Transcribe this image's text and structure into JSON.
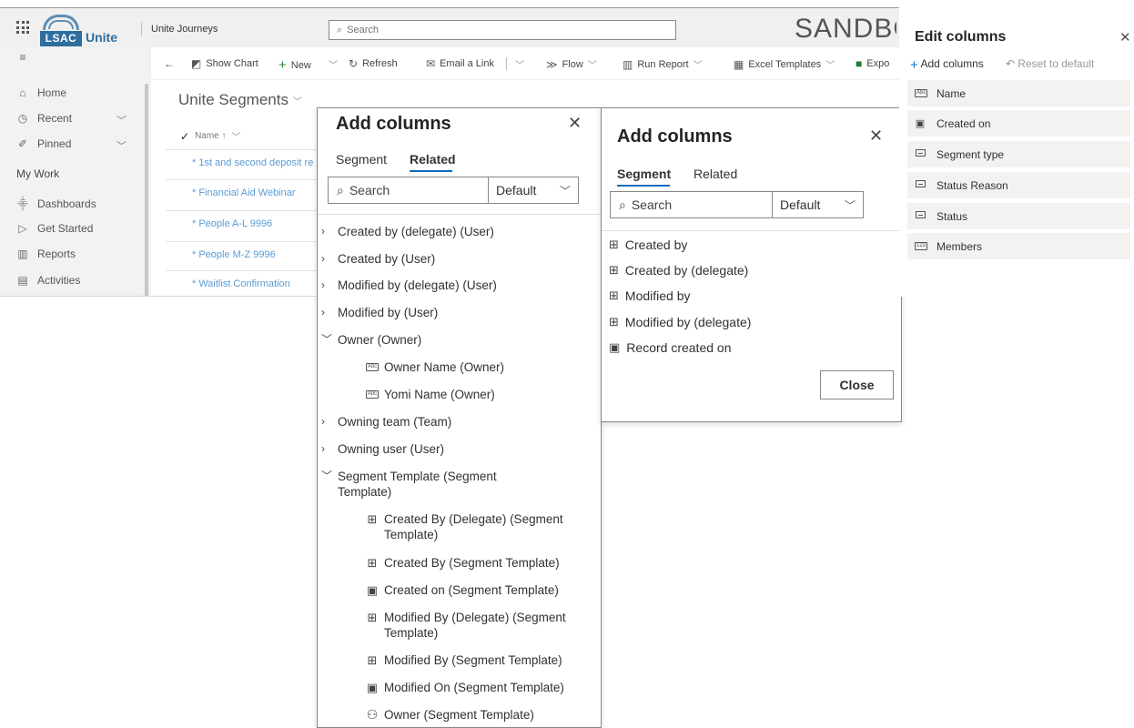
{
  "topbar": {
    "logo_text": "LSAC",
    "logo_suffix": "Unite",
    "app_name": "Unite Journeys",
    "search_placeholder": "Search",
    "environment_label": "SANDBOX"
  },
  "leftnav": {
    "items": [
      {
        "label": "Home",
        "icon": "home-icon"
      },
      {
        "label": "Recent",
        "icon": "clock-icon"
      },
      {
        "label": "Pinned",
        "icon": "pin-icon"
      }
    ],
    "group_label": "My Work",
    "work_items": [
      {
        "label": "Dashboards",
        "icon": "dashboard-icon"
      },
      {
        "label": "Get Started",
        "icon": "play-icon"
      },
      {
        "label": "Reports",
        "icon": "report-icon"
      },
      {
        "label": "Activities",
        "icon": "activities-icon"
      }
    ]
  },
  "commandbar": {
    "show_chart": "Show Chart",
    "new": "New",
    "refresh": "Refresh",
    "email_link": "Email a Link",
    "flow": "Flow",
    "run_report": "Run Report",
    "excel_templates": "Excel Templates",
    "export": "Expo"
  },
  "grid": {
    "title": "Unite Segments",
    "name_header": "Name ↑",
    "rows": [
      "* 1st and second deposit re",
      "* Financial Aid Webinar",
      "* People A-L 9996",
      "* People M-Z 9996",
      "* Waitlist Confirmation"
    ]
  },
  "add_columns_related": {
    "title": "Add columns",
    "tabs": [
      "Segment",
      "Related"
    ],
    "active_tab": "Related",
    "search_placeholder": "Search",
    "filter_value": "Default",
    "items": [
      {
        "label": "Created by (delegate) (User)",
        "expander": "collapsed"
      },
      {
        "label": "Created by (User)",
        "expander": "collapsed"
      },
      {
        "label": "Modified by (delegate) (User)",
        "expander": "collapsed"
      },
      {
        "label": "Modified by (User)",
        "expander": "collapsed"
      },
      {
        "label": "Owner (Owner)",
        "expander": "expanded"
      },
      {
        "label": "Owner Name (Owner)",
        "icon": "text-field-icon"
      },
      {
        "label": "Yomi Name (Owner)",
        "icon": "text-field-icon"
      },
      {
        "label": "Owning team (Team)",
        "expander": "collapsed"
      },
      {
        "label": "Owning user (User)",
        "expander": "collapsed"
      },
      {
        "label": "Segment Template (Segment Template)",
        "expander": "expanded"
      },
      {
        "label": "Created By (Delegate) (Segment Template)",
        "icon": "lookup-icon"
      },
      {
        "label": "Created By (Segment Template)",
        "icon": "lookup-icon"
      },
      {
        "label": "Created on (Segment Template)",
        "icon": "datetime-icon"
      },
      {
        "label": "Modified By (Delegate) (Segment Template)",
        "icon": "lookup-icon"
      },
      {
        "label": "Modified By (Segment Template)",
        "icon": "lookup-icon"
      },
      {
        "label": "Modified On (Segment Template)",
        "icon": "datetime-icon"
      },
      {
        "label": "Owner (Segment Template)",
        "icon": "person-icon"
      }
    ]
  },
  "add_columns_segment": {
    "title": "Add columns",
    "tabs": [
      "Segment",
      "Related"
    ],
    "active_tab": "Segment",
    "search_placeholder": "Search",
    "filter_value": "Default",
    "items": [
      {
        "label": "Created by",
        "icon": "lookup-icon"
      },
      {
        "label": "Created by (delegate)",
        "icon": "lookup-icon"
      },
      {
        "label": "Modified by",
        "icon": "lookup-icon"
      },
      {
        "label": "Modified by (delegate)",
        "icon": "lookup-icon"
      },
      {
        "label": "Record created on",
        "icon": "datetime-icon"
      }
    ],
    "close_label": "Close"
  },
  "edit_columns": {
    "title": "Edit columns",
    "add_columns": "Add columns",
    "reset": "Reset to default",
    "columns": [
      {
        "label": "Name",
        "icon": "text-field-icon"
      },
      {
        "label": "Created on",
        "icon": "datetime-icon"
      },
      {
        "label": "Segment type",
        "icon": "option-set-icon"
      },
      {
        "label": "Status Reason",
        "icon": "option-set-icon"
      },
      {
        "label": "Status",
        "icon": "option-set-icon"
      },
      {
        "label": "Members",
        "icon": "number-field-icon"
      }
    ]
  },
  "colors": {
    "accent": "#0f6cbd",
    "link": "#5b9bd5",
    "nav_bg": "#f3f2f1"
  }
}
